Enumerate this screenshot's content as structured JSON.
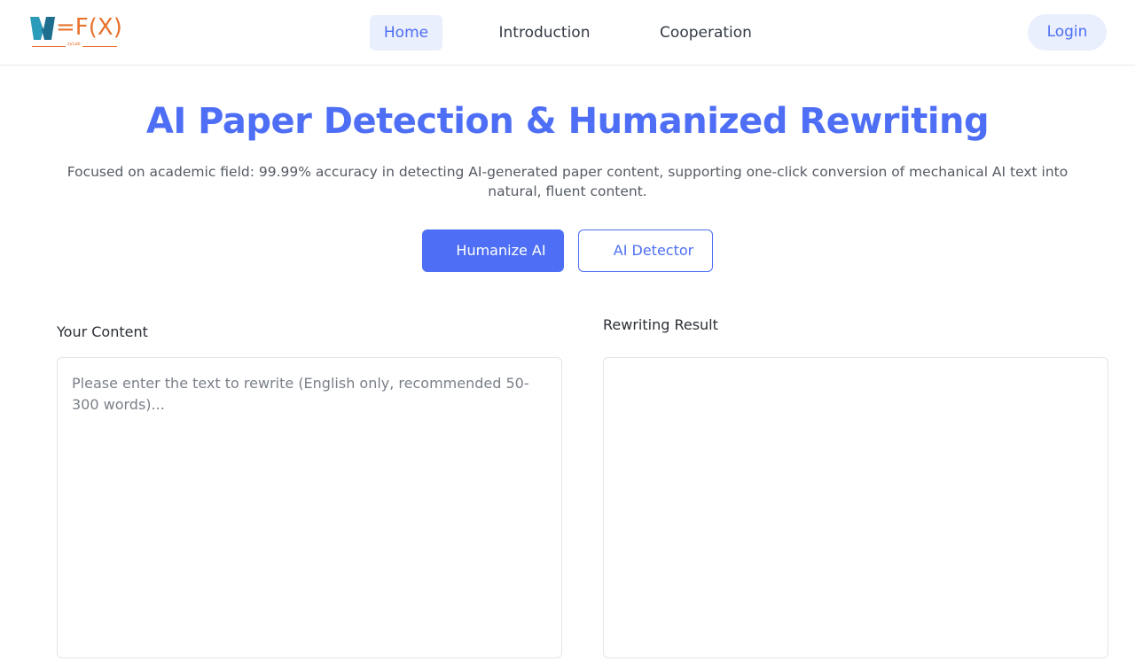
{
  "brand": {
    "logo_text": "=F(X)",
    "logo_subtext": "zyLab",
    "colors": {
      "accent": "#4d6ef5",
      "logo_orange": "#e8722d",
      "logo_teal": "#2a9bb8"
    }
  },
  "nav": {
    "items": [
      {
        "label": "Home",
        "active": true
      },
      {
        "label": "Introduction",
        "active": false
      },
      {
        "label": "Cooperation",
        "active": false
      }
    ],
    "login_label": "Login"
  },
  "hero": {
    "title": "AI Paper Detection & Humanized Rewriting",
    "subtitle": "Focused on academic field: 99.99% accuracy in detecting AI-generated paper content, supporting one-click conversion of mechanical AI text into natural, fluent content.",
    "modes": {
      "humanize_label": "Humanize AI",
      "detector_label": "AI Detector",
      "selected": "Humanize AI"
    }
  },
  "editor": {
    "input_label": "Your Content",
    "input_placeholder": "Please enter the text to rewrite (English only, recommended 50-300 words)...",
    "input_value": "",
    "result_label": "Rewriting Result",
    "result_value": ""
  }
}
